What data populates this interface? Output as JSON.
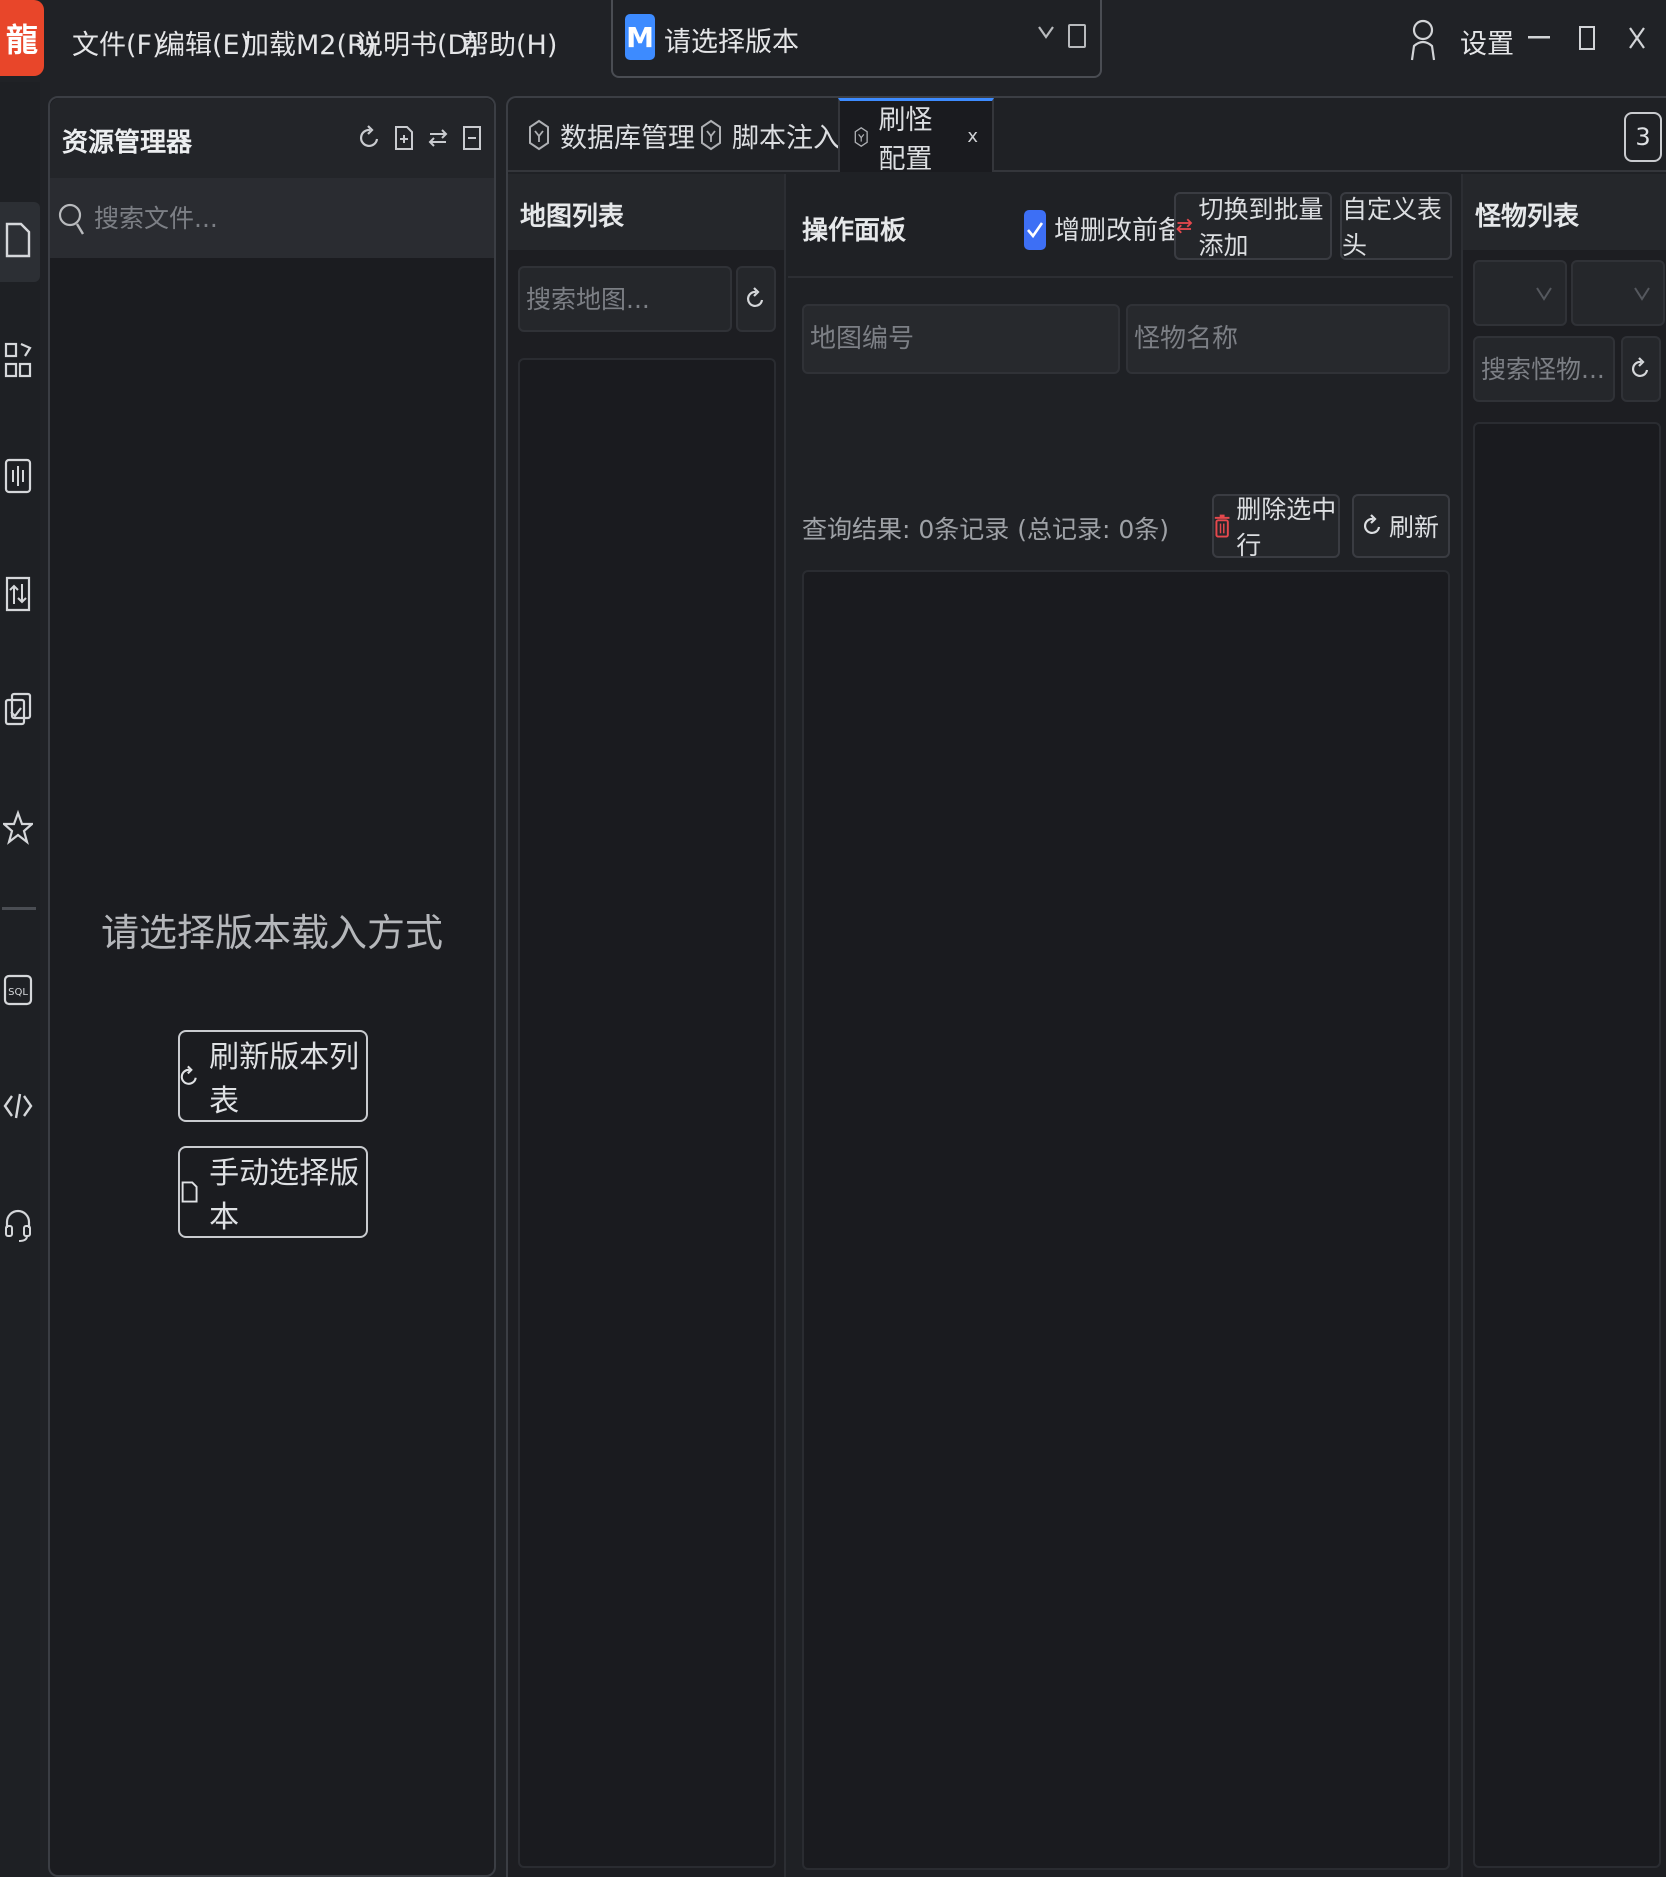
{
  "app": {
    "logo_char": "龍",
    "menu": [
      "文件(F)",
      "编辑(E)",
      "加载M2(R)",
      "说明书(D)",
      "帮助(H)"
    ],
    "version_badge": "M",
    "version_placeholder": "请选择版本",
    "settings_label": "设置",
    "brand_color": "#e8462a",
    "accent_color": "#3d8bff"
  },
  "explorer": {
    "title": "资源管理器",
    "search_placeholder": "搜索文件...",
    "message": "请选择版本载入方式",
    "refresh_versions_label": "刷新版本列表",
    "manual_select_label": "手动选择版本"
  },
  "tabs": [
    {
      "label": "数据库管理",
      "active": false
    },
    {
      "label": "脚本注入",
      "active": false
    },
    {
      "label": "刷怪配置",
      "active": true,
      "close": "x"
    }
  ],
  "tab_count": "3",
  "map_list": {
    "title": "地图列表",
    "search_placeholder": "搜索地图..."
  },
  "op_panel": {
    "title": "操作面板",
    "backup_label": "增删改前备份",
    "backup_checked": true,
    "switch_batch_label": "切换到批量添加",
    "custom_header_label": "自定义表头",
    "map_id_placeholder": "地图编号",
    "monster_name_placeholder": "怪物名称",
    "query_result": "查询结果: 0条记录 (总记录: 0条)",
    "delete_selected_label": "删除选中行",
    "refresh_label": "刷新"
  },
  "monster_list": {
    "title": "怪物列表",
    "search_placeholder": "搜索怪物..."
  }
}
